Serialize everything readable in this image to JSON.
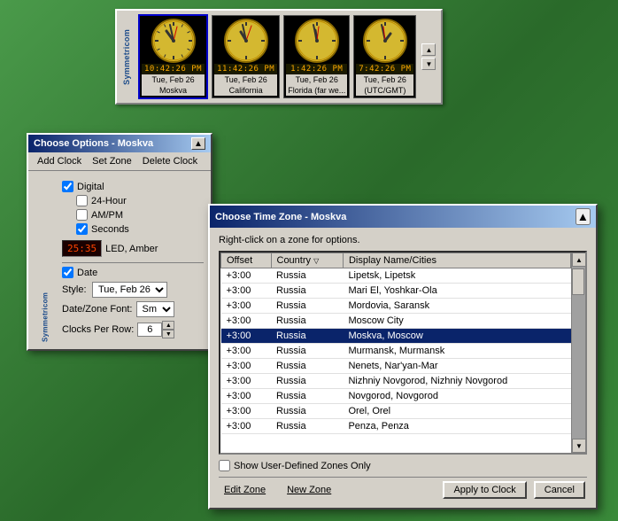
{
  "clockBar": {
    "logoText": "Symmetricom",
    "clocks": [
      {
        "time": "10:42:26 PM",
        "date": "Tue, Feb 26",
        "label": "Moskva",
        "selected": true
      },
      {
        "time": "11:42:26 PM",
        "date": "Tue, Feb 26",
        "label": "California"
      },
      {
        "time": "1:42:26 PM",
        "date": "Tue, Feb 26",
        "label": "Florida (far we..."
      },
      {
        "time": "7:42:26 PM",
        "date": "Tue, Feb 26",
        "label": "(UTC/GMT)"
      }
    ]
  },
  "optionsWindow": {
    "title": "Choose Options - Moskva",
    "menuItems": [
      "Add Clock",
      "Set Zone",
      "Delete Clock"
    ],
    "checkboxes": {
      "digital": {
        "label": "Digital",
        "checked": true
      },
      "hour24": {
        "label": "24-Hour",
        "checked": false
      },
      "ampm": {
        "label": "AM/PM",
        "checked": false
      },
      "seconds": {
        "label": "Seconds",
        "checked": true
      }
    },
    "ledDisplay": "25:35",
    "ledLabel": "LED, Amber",
    "dateCheckbox": {
      "label": "Date",
      "checked": true
    },
    "styleLabel": "Style:",
    "styleValue": "Tue, Feb 26",
    "fontLabel": "Date/Zone Font:",
    "fontValue": "Sm",
    "clocksPerRowLabel": "Clocks Per Row:",
    "clocksPerRowValue": "6"
  },
  "timezoneWindow": {
    "title": "Choose Time Zone - Moskva",
    "hint": "Right-click on a zone for options.",
    "columns": [
      "Offset",
      "Country",
      "Display Name/Cities"
    ],
    "sortColumn": "Country",
    "rows": [
      {
        "offset": "+3:00",
        "country": "Russia",
        "display": "Lipetsk, Lipetsk",
        "selected": false
      },
      {
        "offset": "+3:00",
        "country": "Russia",
        "display": "Mari El, Yoshkar-Ola",
        "selected": false
      },
      {
        "offset": "+3:00",
        "country": "Russia",
        "display": "Mordovia, Saransk",
        "selected": false
      },
      {
        "offset": "+3:00",
        "country": "Russia",
        "display": "Moscow City",
        "selected": false
      },
      {
        "offset": "+3:00",
        "country": "Russia",
        "display": "Moskva, Moscow",
        "selected": true
      },
      {
        "offset": "+3:00",
        "country": "Russia",
        "display": "Murmansk, Murmansk",
        "selected": false
      },
      {
        "offset": "+3:00",
        "country": "Russia",
        "display": "Nenets, Nar'yan-Mar",
        "selected": false
      },
      {
        "offset": "+3:00",
        "country": "Russia",
        "display": "Nizhniy Novgorod, Nizhniy Novgorod",
        "selected": false
      },
      {
        "offset": "+3:00",
        "country": "Russia",
        "display": "Novgorod, Novgorod",
        "selected": false
      },
      {
        "offset": "+3:00",
        "country": "Russia",
        "display": "Orel, Orel",
        "selected": false
      },
      {
        "offset": "+3:00",
        "country": "Russia",
        "display": "Penza, Penza",
        "selected": false
      }
    ],
    "showUserDefined": {
      "label": "Show User-Defined Zones Only",
      "checked": false
    },
    "buttons": {
      "editZone": "Edit Zone",
      "newZone": "New Zone",
      "applyToClock": "Apply to Clock",
      "cancel": "Cancel"
    }
  }
}
